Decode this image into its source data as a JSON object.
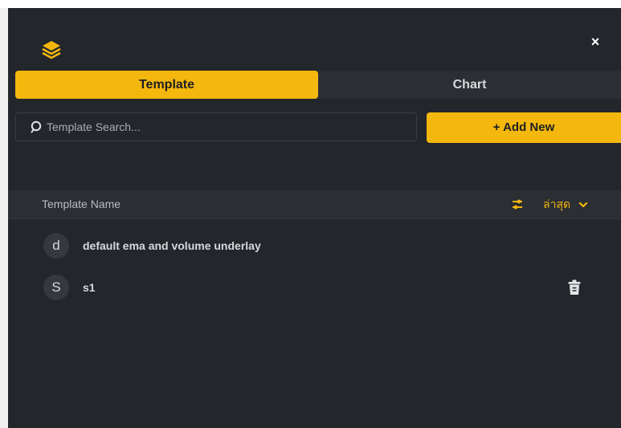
{
  "header": {
    "logo_icon": "layers-icon",
    "close_label": "×"
  },
  "tabs": [
    {
      "label": "Template",
      "active": true
    },
    {
      "label": "Chart",
      "active": false
    }
  ],
  "search": {
    "placeholder": "Template Search...",
    "value": ""
  },
  "add_button": {
    "label": "+ Add New"
  },
  "list": {
    "column_name": "Template Name",
    "filter_icon": "sliders-icon",
    "sort_label": "ล่าสุด",
    "rows": [
      {
        "initial": "d",
        "name": "default ema and volume underlay",
        "deletable": false
      },
      {
        "initial": "S",
        "name": "s1",
        "deletable": true
      }
    ]
  },
  "colors": {
    "accent": "#f4b70d",
    "panel_bg": "#23262b",
    "header_bg": "#2b2e33"
  }
}
